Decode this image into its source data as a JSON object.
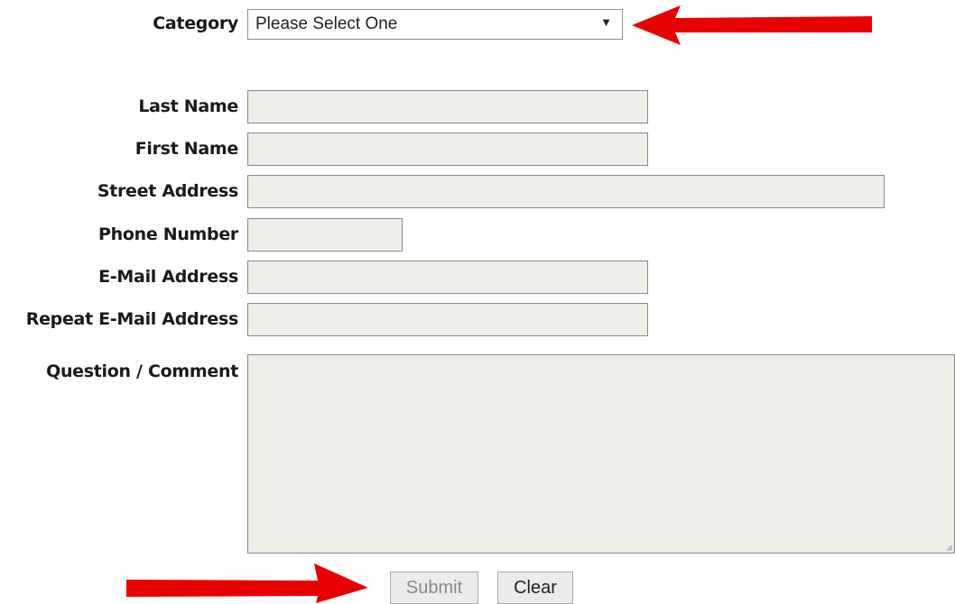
{
  "form": {
    "category": {
      "label": "Category",
      "selected": "Please Select One"
    },
    "fields": [
      {
        "label": "Last Name",
        "value": ""
      },
      {
        "label": "First Name",
        "value": ""
      },
      {
        "label": "Street Address",
        "value": ""
      },
      {
        "label": "Phone Number",
        "value": ""
      },
      {
        "label": "E-Mail Address",
        "value": ""
      },
      {
        "label": "Repeat E-Mail Address",
        "value": ""
      }
    ],
    "comment": {
      "label": "Question / Comment",
      "value": ""
    }
  },
  "buttons": {
    "submit": "Submit",
    "clear": "Clear"
  },
  "annotations": {
    "arrow_color": "#e80000"
  },
  "colors": {
    "field_bg": "#efede7",
    "text": "#1a1a1a"
  },
  "icons": {
    "select_caret": "triangle-down",
    "arrows": "red-arrow"
  }
}
